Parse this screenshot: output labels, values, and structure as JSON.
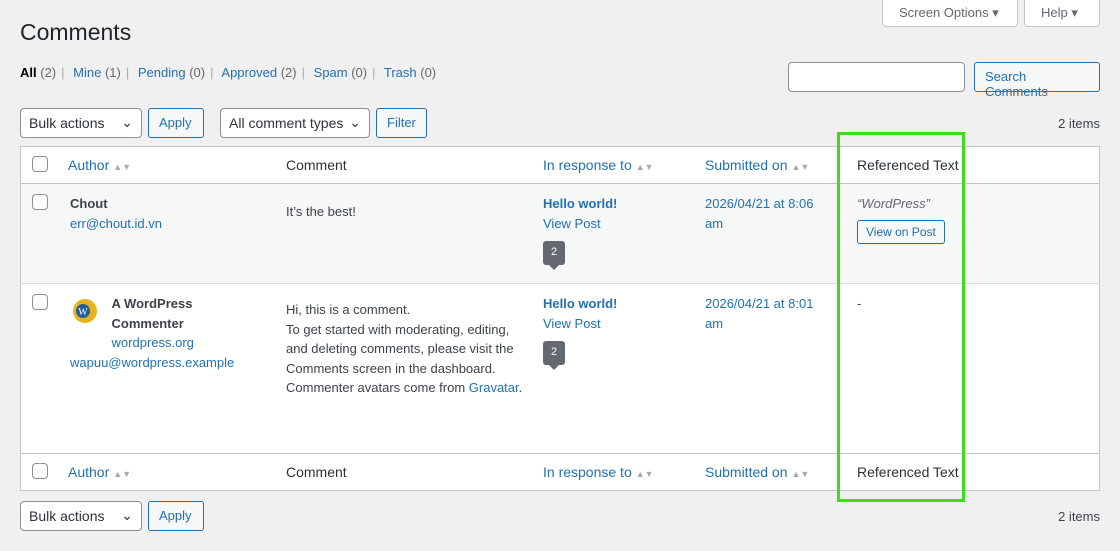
{
  "header": {
    "screen_options": "Screen Options",
    "help": "Help",
    "title": "Comments"
  },
  "filters": [
    {
      "label": "All",
      "count": "(2)"
    },
    {
      "label": "Mine",
      "count": "(1)"
    },
    {
      "label": "Pending",
      "count": "(0)"
    },
    {
      "label": "Approved",
      "count": "(2)"
    },
    {
      "label": "Spam",
      "count": "(0)"
    },
    {
      "label": "Trash",
      "count": "(0)"
    }
  ],
  "search": {
    "value": "",
    "button": "Search Comments"
  },
  "toolbar": {
    "bulk": "Bulk actions",
    "apply": "Apply",
    "types": "All comment types",
    "filter": "Filter",
    "items": "2 items"
  },
  "columns": {
    "author": "Author",
    "comment": "Comment",
    "response": "In response to",
    "submitted": "Submitted on",
    "ref": "Referenced Text"
  },
  "rows": [
    {
      "author": "Chout",
      "email": "err@chout.id.vn",
      "url": "",
      "comment": [
        "It’s the best!"
      ],
      "post": "Hello world!",
      "view": "View Post",
      "count": "2",
      "date": "2026/04/21 at 8:06 am",
      "ref": "“WordPress”",
      "ref_btn": "View on Post"
    },
    {
      "author": "A WordPress Commenter",
      "url": "wordpress.org",
      "email": "wapuu@wordpress.example",
      "comment": [
        "Hi, this is a comment.",
        "To get started with moderating, editing,",
        "and deleting comments, please visit the",
        "Comments screen in the dashboard.",
        "Commenter avatars come from "
      ],
      "comment_link": "Gravatar",
      "comment_end": ".",
      "post": "Hello world!",
      "view": "View Post",
      "count": "2",
      "date": "2026/04/21 at 8:01 am",
      "ref": "-"
    }
  ]
}
